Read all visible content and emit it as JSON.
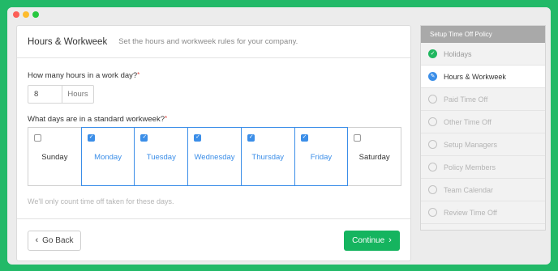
{
  "window": {
    "controls": [
      "close",
      "minimize",
      "maximize"
    ]
  },
  "card": {
    "title": "Hours & Workweek",
    "subtitle": "Set the hours and workweek rules for your company."
  },
  "hours": {
    "question": "How many hours in a work day?",
    "required_mark": "*",
    "value": "8",
    "unit": "Hours"
  },
  "workweek": {
    "question": "What days are in a standard workweek?",
    "required_mark": "*",
    "days": [
      {
        "label": "Sunday",
        "checked": false
      },
      {
        "label": "Monday",
        "checked": true
      },
      {
        "label": "Tuesday",
        "checked": true
      },
      {
        "label": "Wednesday",
        "checked": true
      },
      {
        "label": "Thursday",
        "checked": true
      },
      {
        "label": "Friday",
        "checked": true
      },
      {
        "label": "Saturday",
        "checked": false
      }
    ],
    "hint": "We'll only count time off taken for these days."
  },
  "footer": {
    "back_label": "Go Back",
    "continue_label": "Continue",
    "back_icon": "‹",
    "continue_icon": "›"
  },
  "sidebar": {
    "header": "Setup Time Off Policy",
    "items": [
      {
        "label": "Holidays",
        "state": "done"
      },
      {
        "label": "Hours & Workweek",
        "state": "active"
      },
      {
        "label": "Paid Time Off",
        "state": "pending"
      },
      {
        "label": "Other Time Off",
        "state": "pending"
      },
      {
        "label": "Setup Managers",
        "state": "pending"
      },
      {
        "label": "Policy Members",
        "state": "pending"
      },
      {
        "label": "Team Calendar",
        "state": "pending"
      },
      {
        "label": "Review Time Off",
        "state": "pending"
      }
    ]
  },
  "colors": {
    "background": "#22b968",
    "accent_blue": "#3b8ee8",
    "continue_green": "#15b45f",
    "required_red": "#e0463e"
  }
}
